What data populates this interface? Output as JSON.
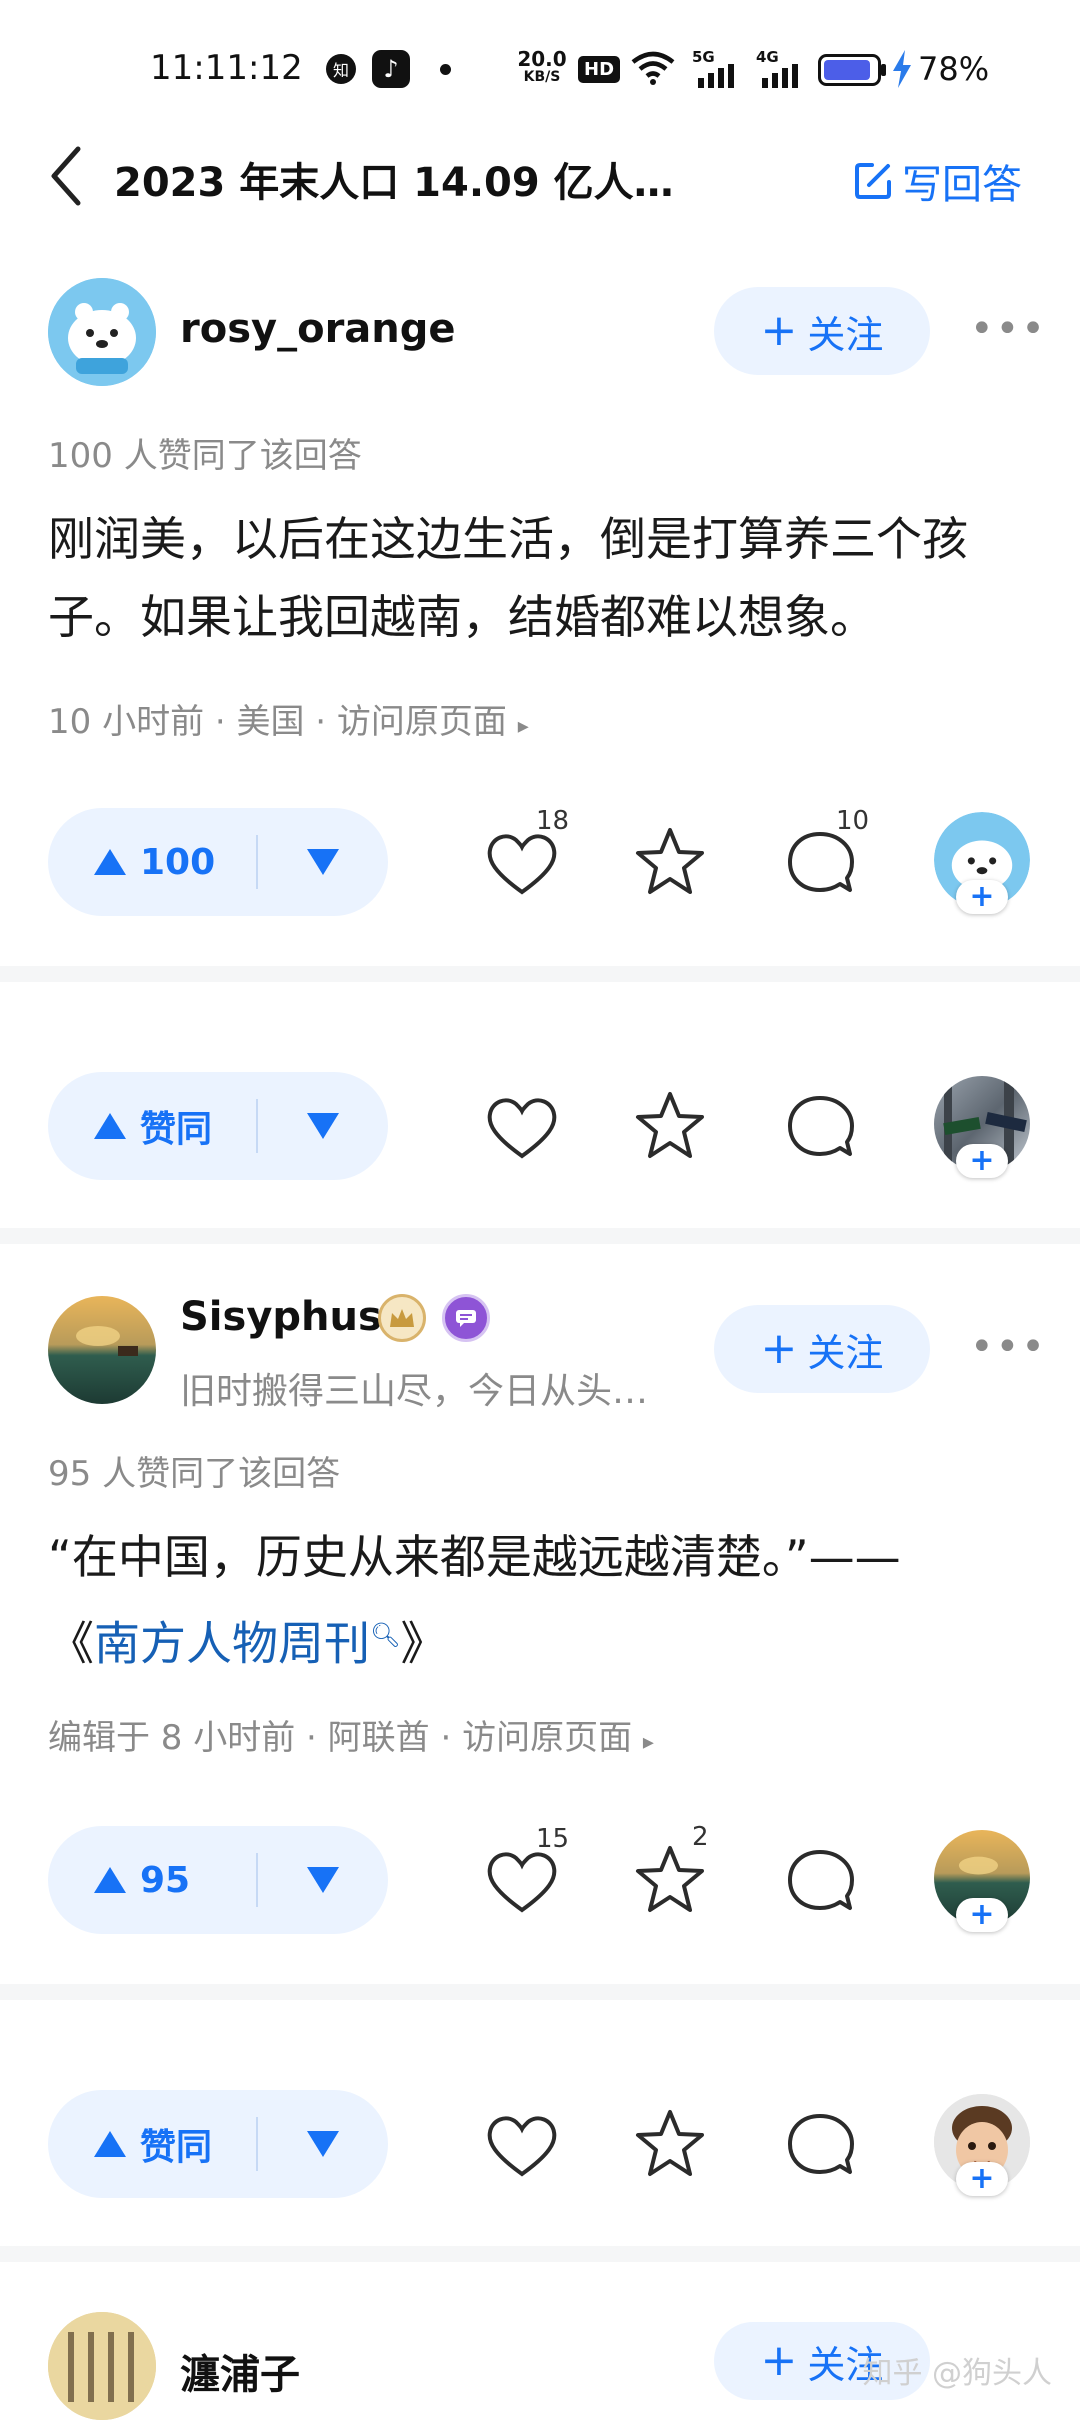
{
  "status_bar": {
    "time": "11:11:12",
    "net_speed_top": "20.0",
    "net_speed_unit": "KB/S",
    "hd": "HD",
    "net1": "5G",
    "net2": "4G",
    "battery": "78%"
  },
  "header": {
    "title": "2023 年末人口 14.09 亿人…",
    "write_answer": "写回答"
  },
  "answers": [
    {
      "author": "rosy_orange",
      "follow": "关注",
      "upvote_text": "100 人赞同了该回答",
      "content": "刚润美，以后在这边生活，倒是打算养三个孩子。如果让我回越南，结婚都难以想象。",
      "meta": "10 小时前 · 美国 · 访问原页面",
      "vote_label": "100",
      "likes": "18",
      "stars": "",
      "comments": "10"
    },
    {
      "vote_label": "赞同"
    },
    {
      "author": "Sisyphus",
      "bio": "旧时搬得三山尽，今日从头…",
      "follow": "关注",
      "upvote_text": "95 人赞同了该回答",
      "content_pre": "“在中国，历史从来都是越远越清楚。”——",
      "content_link_open": "《",
      "content_link": "南方人物周刊",
      "content_link_close": "》",
      "meta": "编辑于 8 小时前 · 阿联酋 · 访问原页面",
      "vote_label": "95",
      "likes": "15",
      "stars": "2",
      "comments": ""
    },
    {
      "vote_label": "赞同"
    },
    {
      "author": "瀍浦子",
      "follow": "关注"
    }
  ],
  "watermark": "知乎 @狗头人",
  "colors": {
    "accent": "#1772f6",
    "follow_bg": "#ebf3ff",
    "meta": "#8a8a8a",
    "link": "#1660b5"
  }
}
